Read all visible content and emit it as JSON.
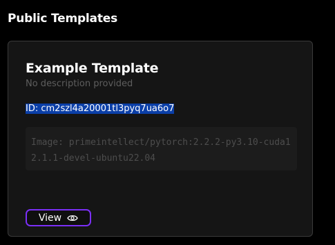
{
  "section": {
    "title": "Public Templates"
  },
  "template_card": {
    "title": "Example Template",
    "description": "No description provided",
    "id_text": "ID: cm2szl4a20001tl3pyq7ua6o7",
    "image_text": "Image: primeintellect/pytorch:2.2.2-py3.10-cuda12.1.1-devel-ubuntu22.04",
    "view_label": "View",
    "view_icon": "eye-icon"
  },
  "colors": {
    "accent": "#7b2ff7",
    "selection": "#0b3fa8",
    "card_background": "#151515"
  }
}
